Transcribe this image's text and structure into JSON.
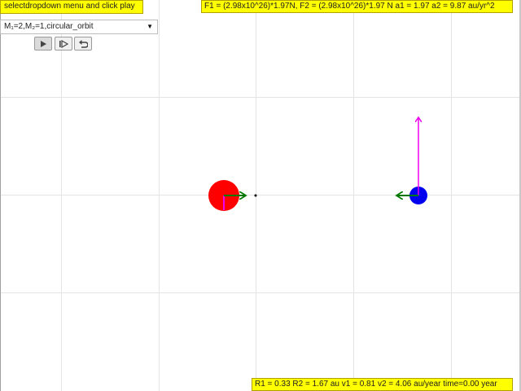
{
  "app": {
    "hint_text": "selectdropdown menu and click play",
    "forces_text": "F1 = (2.98x10^26)*1.97N, F2 = (2.98x10^26)*1.97 N a1 = 1.97 a2 = 9.87 au/yr^2",
    "status_text": "R1 = 0.33 R2 = 1.67 au v1 = 0.81 v2 = 4.06 au/year time=0.00 year"
  },
  "dropdown": {
    "selected": "M₁=2,M₂=1,circular_orbit",
    "icon": "chevron-down-icon"
  },
  "controls": {
    "play_icon": "play-icon",
    "step_icon": "step-forward-icon",
    "reset_icon": "reset-icon"
  },
  "colors": {
    "highlight": "#ffff00",
    "mass1": "#ff0000",
    "mass2": "#0000ee",
    "velocity_vector": "#ee00ee",
    "force_vector": "#007700",
    "grid": "#e4e4e4"
  }
}
